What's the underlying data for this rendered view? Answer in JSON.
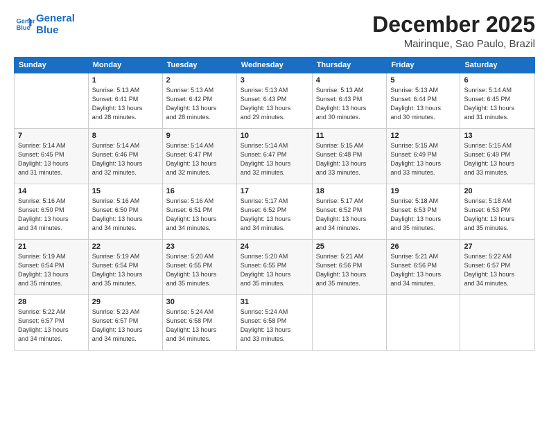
{
  "logo": {
    "line1": "General",
    "line2": "Blue"
  },
  "title": "December 2025",
  "location": "Mairinque, Sao Paulo, Brazil",
  "days_header": [
    "Sunday",
    "Monday",
    "Tuesday",
    "Wednesday",
    "Thursday",
    "Friday",
    "Saturday"
  ],
  "weeks": [
    [
      {
        "num": "",
        "lines": []
      },
      {
        "num": "1",
        "lines": [
          "Sunrise: 5:13 AM",
          "Sunset: 6:41 PM",
          "Daylight: 13 hours",
          "and 28 minutes."
        ]
      },
      {
        "num": "2",
        "lines": [
          "Sunrise: 5:13 AM",
          "Sunset: 6:42 PM",
          "Daylight: 13 hours",
          "and 28 minutes."
        ]
      },
      {
        "num": "3",
        "lines": [
          "Sunrise: 5:13 AM",
          "Sunset: 6:43 PM",
          "Daylight: 13 hours",
          "and 29 minutes."
        ]
      },
      {
        "num": "4",
        "lines": [
          "Sunrise: 5:13 AM",
          "Sunset: 6:43 PM",
          "Daylight: 13 hours",
          "and 30 minutes."
        ]
      },
      {
        "num": "5",
        "lines": [
          "Sunrise: 5:13 AM",
          "Sunset: 6:44 PM",
          "Daylight: 13 hours",
          "and 30 minutes."
        ]
      },
      {
        "num": "6",
        "lines": [
          "Sunrise: 5:14 AM",
          "Sunset: 6:45 PM",
          "Daylight: 13 hours",
          "and 31 minutes."
        ]
      }
    ],
    [
      {
        "num": "7",
        "lines": [
          "Sunrise: 5:14 AM",
          "Sunset: 6:45 PM",
          "Daylight: 13 hours",
          "and 31 minutes."
        ]
      },
      {
        "num": "8",
        "lines": [
          "Sunrise: 5:14 AM",
          "Sunset: 6:46 PM",
          "Daylight: 13 hours",
          "and 32 minutes."
        ]
      },
      {
        "num": "9",
        "lines": [
          "Sunrise: 5:14 AM",
          "Sunset: 6:47 PM",
          "Daylight: 13 hours",
          "and 32 minutes."
        ]
      },
      {
        "num": "10",
        "lines": [
          "Sunrise: 5:14 AM",
          "Sunset: 6:47 PM",
          "Daylight: 13 hours",
          "and 32 minutes."
        ]
      },
      {
        "num": "11",
        "lines": [
          "Sunrise: 5:15 AM",
          "Sunset: 6:48 PM",
          "Daylight: 13 hours",
          "and 33 minutes."
        ]
      },
      {
        "num": "12",
        "lines": [
          "Sunrise: 5:15 AM",
          "Sunset: 6:49 PM",
          "Daylight: 13 hours",
          "and 33 minutes."
        ]
      },
      {
        "num": "13",
        "lines": [
          "Sunrise: 5:15 AM",
          "Sunset: 6:49 PM",
          "Daylight: 13 hours",
          "and 33 minutes."
        ]
      }
    ],
    [
      {
        "num": "14",
        "lines": [
          "Sunrise: 5:16 AM",
          "Sunset: 6:50 PM",
          "Daylight: 13 hours",
          "and 34 minutes."
        ]
      },
      {
        "num": "15",
        "lines": [
          "Sunrise: 5:16 AM",
          "Sunset: 6:50 PM",
          "Daylight: 13 hours",
          "and 34 minutes."
        ]
      },
      {
        "num": "16",
        "lines": [
          "Sunrise: 5:16 AM",
          "Sunset: 6:51 PM",
          "Daylight: 13 hours",
          "and 34 minutes."
        ]
      },
      {
        "num": "17",
        "lines": [
          "Sunrise: 5:17 AM",
          "Sunset: 6:52 PM",
          "Daylight: 13 hours",
          "and 34 minutes."
        ]
      },
      {
        "num": "18",
        "lines": [
          "Sunrise: 5:17 AM",
          "Sunset: 6:52 PM",
          "Daylight: 13 hours",
          "and 34 minutes."
        ]
      },
      {
        "num": "19",
        "lines": [
          "Sunrise: 5:18 AM",
          "Sunset: 6:53 PM",
          "Daylight: 13 hours",
          "and 35 minutes."
        ]
      },
      {
        "num": "20",
        "lines": [
          "Sunrise: 5:18 AM",
          "Sunset: 6:53 PM",
          "Daylight: 13 hours",
          "and 35 minutes."
        ]
      }
    ],
    [
      {
        "num": "21",
        "lines": [
          "Sunrise: 5:19 AM",
          "Sunset: 6:54 PM",
          "Daylight: 13 hours",
          "and 35 minutes."
        ]
      },
      {
        "num": "22",
        "lines": [
          "Sunrise: 5:19 AM",
          "Sunset: 6:54 PM",
          "Daylight: 13 hours",
          "and 35 minutes."
        ]
      },
      {
        "num": "23",
        "lines": [
          "Sunrise: 5:20 AM",
          "Sunset: 6:55 PM",
          "Daylight: 13 hours",
          "and 35 minutes."
        ]
      },
      {
        "num": "24",
        "lines": [
          "Sunrise: 5:20 AM",
          "Sunset: 6:55 PM",
          "Daylight: 13 hours",
          "and 35 minutes."
        ]
      },
      {
        "num": "25",
        "lines": [
          "Sunrise: 5:21 AM",
          "Sunset: 6:56 PM",
          "Daylight: 13 hours",
          "and 35 minutes."
        ]
      },
      {
        "num": "26",
        "lines": [
          "Sunrise: 5:21 AM",
          "Sunset: 6:56 PM",
          "Daylight: 13 hours",
          "and 34 minutes."
        ]
      },
      {
        "num": "27",
        "lines": [
          "Sunrise: 5:22 AM",
          "Sunset: 6:57 PM",
          "Daylight: 13 hours",
          "and 34 minutes."
        ]
      }
    ],
    [
      {
        "num": "28",
        "lines": [
          "Sunrise: 5:22 AM",
          "Sunset: 6:57 PM",
          "Daylight: 13 hours",
          "and 34 minutes."
        ]
      },
      {
        "num": "29",
        "lines": [
          "Sunrise: 5:23 AM",
          "Sunset: 6:57 PM",
          "Daylight: 13 hours",
          "and 34 minutes."
        ]
      },
      {
        "num": "30",
        "lines": [
          "Sunrise: 5:24 AM",
          "Sunset: 6:58 PM",
          "Daylight: 13 hours",
          "and 34 minutes."
        ]
      },
      {
        "num": "31",
        "lines": [
          "Sunrise: 5:24 AM",
          "Sunset: 6:58 PM",
          "Daylight: 13 hours",
          "and 33 minutes."
        ]
      },
      {
        "num": "",
        "lines": []
      },
      {
        "num": "",
        "lines": []
      },
      {
        "num": "",
        "lines": []
      }
    ]
  ]
}
